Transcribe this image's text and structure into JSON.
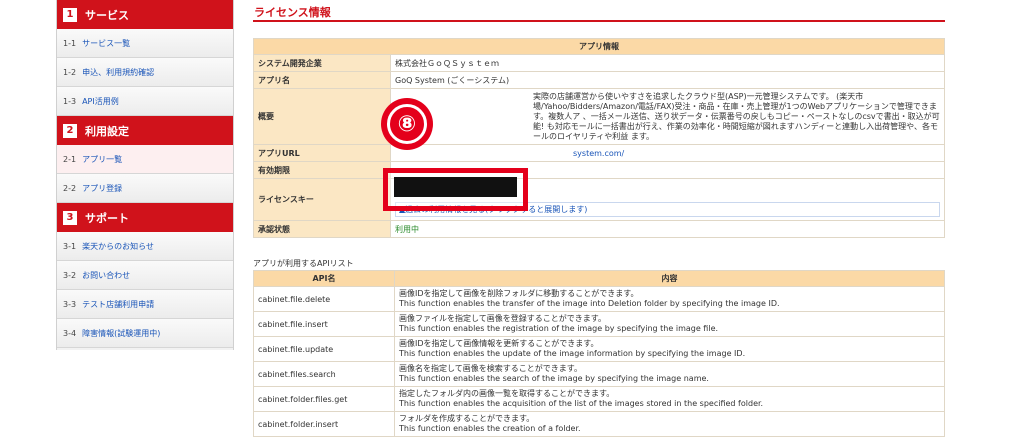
{
  "sidebar": {
    "sections": [
      {
        "num": "1",
        "title": "サービス",
        "items": [
          {
            "idx": "1-1",
            "label": "サービス一覧"
          },
          {
            "idx": "1-2",
            "label": "申込、利用規約確認"
          },
          {
            "idx": "1-3",
            "label": "API活用例"
          }
        ]
      },
      {
        "num": "2",
        "title": "利用設定",
        "items": [
          {
            "idx": "2-1",
            "label": "アプリ一覧"
          },
          {
            "idx": "2-2",
            "label": "アプリ登録"
          }
        ]
      },
      {
        "num": "3",
        "title": "サポート",
        "items": [
          {
            "idx": "3-1",
            "label": "楽天からのお知らせ"
          },
          {
            "idx": "3-2",
            "label": "お問い合わせ"
          },
          {
            "idx": "3-3",
            "label": "テスト店舗利用申請"
          },
          {
            "idx": "3-4",
            "label": "障害情報(試験運用中)"
          }
        ]
      }
    ]
  },
  "main": {
    "title": "ライセンス情報",
    "info_header": "アプリ情報",
    "rows": {
      "developer_key": "システム開発企業",
      "developer_val": "株式会社ＧｏＱＳｙｓｔｅｍ",
      "app_name_key": "アプリ名",
      "app_name_val": "GoQ System (ごくーシステム)",
      "overview_key": "概要",
      "overview_val": "実際の店舗運営から使いやすさを追求したクラウド型(ASP)一元管理システムです。 (楽天市場/Yahoo/Bidders/Amazon/電話/FAX)受注・商品・在庫・売上管理が1つのWebアプリケーションで管理できます。複数人ア 、一括メール送信、送り状データ・伝票番号の戻しもコピー・ペーストなしのcsvで書出・取込が可能! も対応モールに一括書出が行え、作業の効率化・時間短縮が図れますハンディーと連動し入出荷管理や、各モールのロイヤリティや利益 ます。",
      "url_key": "アプリURL",
      "url_val": "system.com/",
      "expiry_key": "有効期限",
      "license_key": "ライセンスキー",
      "history_link": "▲過去の利用情報を見る(クリックすると展開します)",
      "approval_key": "承認状態",
      "approval_val": "利用中"
    },
    "api_caption": "アプリが利用するAPIリスト",
    "api_headers": {
      "name": "API名",
      "content": "内容"
    },
    "apis": [
      {
        "name": "cabinet.file.delete",
        "jp": "画像IDを指定して画像を削除フォルダに移動することができます。",
        "en": "This function enables the transfer of the image into Deletion folder by specifying the image ID."
      },
      {
        "name": "cabinet.file.insert",
        "jp": "画像ファイルを指定して画像を登録することができます。",
        "en": "This function enables the registration of the image by specifying the image file."
      },
      {
        "name": "cabinet.file.update",
        "jp": "画像IDを指定して画像情報を更新することができます。",
        "en": "This function enables the update of the image information by specifying the image ID."
      },
      {
        "name": "cabinet.files.search",
        "jp": "画像名を指定して画像を検索することができます。",
        "en": "This function enables the search of the image by specifying the image name."
      },
      {
        "name": "cabinet.folder.files.get",
        "jp": "指定したフォルダ内の画像一覧を取得することができます。",
        "en": "This function enables the acquisition of the list of the images stored in the specified folder."
      },
      {
        "name": "cabinet.folder.insert",
        "jp": "フォルダを作成することができます。",
        "en": "This function enables the creation of a folder."
      }
    ]
  },
  "annotation": {
    "step": "⑧"
  },
  "colors": {
    "accent": "#d0121b",
    "header_bg": "#fbd9a6",
    "key_bg": "#fbe7c4",
    "link": "#1a55b8",
    "highlight": "#e4001b"
  }
}
